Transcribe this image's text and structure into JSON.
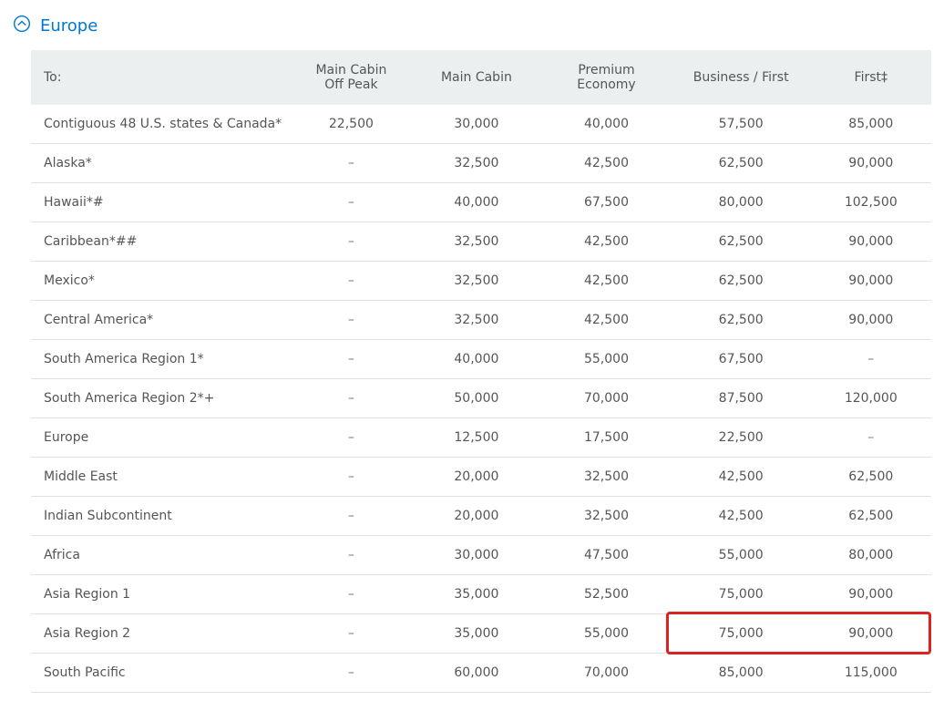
{
  "section": {
    "title": "Europe"
  },
  "columns": {
    "to": "To:",
    "offpeak_line1": "Main Cabin",
    "offpeak_line2": "Off Peak",
    "main": "Main Cabin",
    "pe_line1": "Premium",
    "pe_line2": "Economy",
    "bf": "Business / First",
    "first": "First‡"
  },
  "rows": [
    {
      "to": "Contiguous 48 U.S. states & Canada*",
      "offpeak": "22,500",
      "main": "30,000",
      "pe": "40,000",
      "bf": "57,500",
      "first": "85,000"
    },
    {
      "to": "Alaska*",
      "offpeak": "–",
      "main": "32,500",
      "pe": "42,500",
      "bf": "62,500",
      "first": "90,000"
    },
    {
      "to": "Hawaii*#",
      "offpeak": "–",
      "main": "40,000",
      "pe": "67,500",
      "bf": "80,000",
      "first": "102,500"
    },
    {
      "to": "Caribbean*##",
      "offpeak": "–",
      "main": "32,500",
      "pe": "42,500",
      "bf": "62,500",
      "first": "90,000"
    },
    {
      "to": "Mexico*",
      "offpeak": "–",
      "main": "32,500",
      "pe": "42,500",
      "bf": "62,500",
      "first": "90,000"
    },
    {
      "to": "Central America*",
      "offpeak": "–",
      "main": "32,500",
      "pe": "42,500",
      "bf": "62,500",
      "first": "90,000"
    },
    {
      "to": "South America Region 1*",
      "offpeak": "–",
      "main": "40,000",
      "pe": "55,000",
      "bf": "67,500",
      "first": "–"
    },
    {
      "to": "South America Region 2*+",
      "offpeak": "–",
      "main": "50,000",
      "pe": "70,000",
      "bf": "87,500",
      "first": "120,000"
    },
    {
      "to": "Europe",
      "offpeak": "–",
      "main": "12,500",
      "pe": "17,500",
      "bf": "22,500",
      "first": "–"
    },
    {
      "to": "Middle East",
      "offpeak": "–",
      "main": "20,000",
      "pe": "32,500",
      "bf": "42,500",
      "first": "62,500"
    },
    {
      "to": "Indian Subcontinent",
      "offpeak": "–",
      "main": "20,000",
      "pe": "32,500",
      "bf": "42,500",
      "first": "62,500"
    },
    {
      "to": "Africa",
      "offpeak": "–",
      "main": "30,000",
      "pe": "47,500",
      "bf": "55,000",
      "first": "80,000"
    },
    {
      "to": "Asia Region 1",
      "offpeak": "–",
      "main": "35,000",
      "pe": "52,500",
      "bf": "75,000",
      "first": "90,000"
    },
    {
      "to": "Asia Region 2",
      "offpeak": "–",
      "main": "35,000",
      "pe": "55,000",
      "bf": "75,000",
      "first": "90,000"
    },
    {
      "to": "South Pacific",
      "offpeak": "–",
      "main": "60,000",
      "pe": "70,000",
      "bf": "85,000",
      "first": "115,000"
    }
  ],
  "highlight_row_index": 13
}
